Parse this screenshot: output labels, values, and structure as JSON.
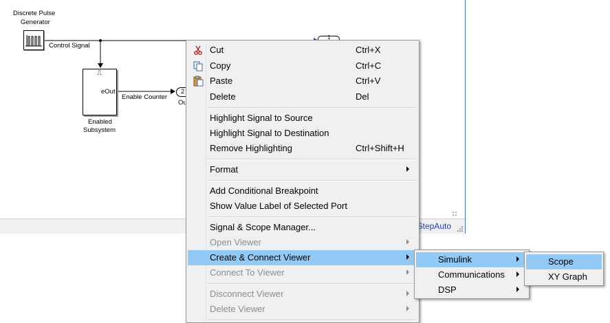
{
  "model": {
    "pulse_block_label_line1": "Discrete Pulse",
    "pulse_block_label_line2": "Generator",
    "control_signal_label": "Control Signal",
    "subsystem_label_line1": "Enabled",
    "subsystem_label_line2": "Subsystem",
    "subsystem_port_label": "eOut",
    "enable_symbol": "⎍",
    "enable_counter_label": "Enable Counter",
    "outport_number": "2",
    "outport_label_partial": "Ou",
    "outport2_number": "1"
  },
  "status_bar": {
    "solver_text": "StepAuto"
  },
  "context_menu": {
    "items": [
      {
        "label": "Cut",
        "mnemonic_index": 2,
        "shortcut": "Ctrl+X",
        "icon": "cut-icon"
      },
      {
        "label": "Copy",
        "shortcut": "Ctrl+C",
        "icon": "copy-icon"
      },
      {
        "label": "Paste",
        "shortcut": "Ctrl+V",
        "icon": "paste-icon"
      },
      {
        "label": "Delete",
        "shortcut": "Del"
      },
      {
        "label": "Highlight Signal to Source"
      },
      {
        "label": "Highlight Signal to Destination"
      },
      {
        "label": "Remove Highlighting",
        "shortcut": "Ctrl+Shift+H"
      },
      {
        "label": "Format"
      },
      {
        "label": "Add Conditional Breakpoint"
      },
      {
        "label": "Show Value Label of Selected Port"
      },
      {
        "label": "Signal & Scope Manager..."
      },
      {
        "label": "Open Viewer"
      },
      {
        "label": "Create & Connect Viewer"
      },
      {
        "label": "Connect To Viewer"
      },
      {
        "label": "Disconnect Viewer"
      },
      {
        "label": "Delete Viewer"
      }
    ]
  },
  "viewer_submenu": {
    "items": [
      {
        "label": "Simulink"
      },
      {
        "label": "Communications"
      },
      {
        "label": "DSP"
      }
    ]
  },
  "simulink_submenu": {
    "items": [
      {
        "label": "Scope"
      },
      {
        "label": "XY Graph"
      }
    ]
  },
  "colors": {
    "highlight": "#91c9f7",
    "menu_bg": "#f0f0f0",
    "disabled_text": "#8c8c8c",
    "window_border": "#3f79c8",
    "status_link": "#1f3fbf"
  }
}
